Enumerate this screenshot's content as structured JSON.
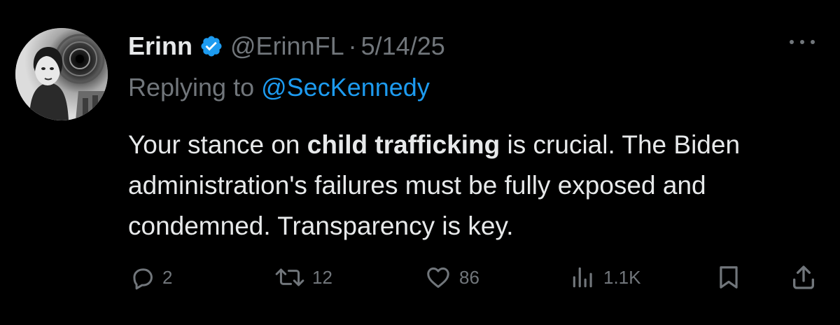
{
  "tweet": {
    "author": {
      "display_name": "Erinn",
      "handle": "@ErinnFL",
      "verified": true,
      "verified_icon": "verified-badge-icon",
      "avatar": "avatar"
    },
    "separator": "·",
    "date": "5/14/25",
    "more_icon": "more-options-icon",
    "replying_prefix": "Replying to",
    "replying_to": "@SecKennedy",
    "text_parts": [
      "Your stance on ",
      "child trafficking",
      " is crucial. The Biden administration's failures must be fully exposed and condemned. Transparency is key."
    ]
  },
  "actions": {
    "reply": {
      "icon": "reply-icon",
      "count": "2"
    },
    "retweet": {
      "icon": "retweet-icon",
      "count": "12"
    },
    "like": {
      "icon": "heart-icon",
      "count": "86"
    },
    "views": {
      "icon": "views-icon",
      "count": "1.1K"
    },
    "bookmark": {
      "icon": "bookmark-icon"
    },
    "share": {
      "icon": "share-icon"
    }
  },
  "colors": {
    "background": "#000000",
    "primary_text": "#e7e9ea",
    "secondary_text": "#71767b",
    "link": "#1d9bf0",
    "verified": "#1d9bf0"
  }
}
